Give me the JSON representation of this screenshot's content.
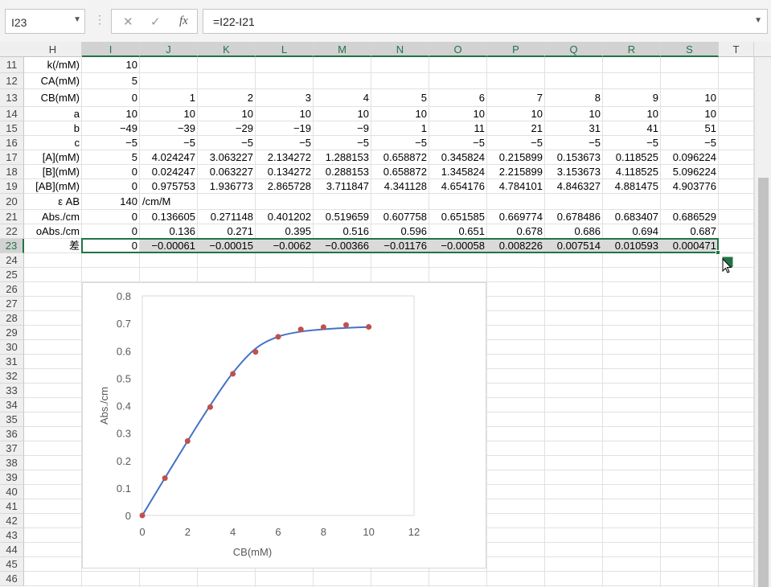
{
  "formula_bar": {
    "name_box": "I23",
    "cancel_glyph": "✕",
    "enter_glyph": "✓",
    "fx_glyph": "fx",
    "formula": "=I22-I21"
  },
  "columns": [
    "H",
    "I",
    "J",
    "K",
    "L",
    "M",
    "N",
    "O",
    "P",
    "Q",
    "R",
    "S",
    "T"
  ],
  "rows": [
    {
      "n": "11",
      "label": "k(/mM)",
      "cells": [
        "10"
      ]
    },
    {
      "n": "12",
      "label": "CA(mM)",
      "cells": [
        "5"
      ]
    },
    {
      "n": "13",
      "label": "CB(mM)",
      "cells": [
        "0",
        "1",
        "2",
        "3",
        "4",
        "5",
        "6",
        "7",
        "8",
        "9",
        "10"
      ]
    },
    {
      "n": "14",
      "label": "a",
      "cells": [
        "10",
        "10",
        "10",
        "10",
        "10",
        "10",
        "10",
        "10",
        "10",
        "10",
        "10"
      ]
    },
    {
      "n": "15",
      "label": "b",
      "cells": [
        "−49",
        "−39",
        "−29",
        "−19",
        "−9",
        "1",
        "11",
        "21",
        "31",
        "41",
        "51"
      ]
    },
    {
      "n": "16",
      "label": "c",
      "cells": [
        "−5",
        "−5",
        "−5",
        "−5",
        "−5",
        "−5",
        "−5",
        "−5",
        "−5",
        "−5",
        "−5"
      ]
    },
    {
      "n": "17",
      "label": "[A](mM)",
      "cells": [
        "5",
        "4.024247",
        "3.063227",
        "2.134272",
        "1.288153",
        "0.658872",
        "0.345824",
        "0.215899",
        "0.153673",
        "0.118525",
        "0.096224"
      ]
    },
    {
      "n": "18",
      "label": "[B](mM)",
      "cells": [
        "0",
        "0.024247",
        "0.063227",
        "0.134272",
        "0.288153",
        "0.658872",
        "1.345824",
        "2.215899",
        "3.153673",
        "4.118525",
        "5.096224"
      ]
    },
    {
      "n": "19",
      "label": "[AB](mM)",
      "cells": [
        "0",
        "0.975753",
        "1.936773",
        "2.865728",
        "3.711847",
        "4.341128",
        "4.654176",
        "4.784101",
        "4.846327",
        "4.881475",
        "4.903776"
      ]
    },
    {
      "n": "20",
      "label": "ε AB",
      "cells": [
        "140",
        "/cm/M"
      ]
    },
    {
      "n": "21",
      "label": "Abs./cm",
      "cells": [
        "0",
        "0.136605",
        "0.271148",
        "0.401202",
        "0.519659",
        "0.607758",
        "0.651585",
        "0.669774",
        "0.678486",
        "0.683407",
        "0.686529"
      ]
    },
    {
      "n": "22",
      "label": "oAbs./cm",
      "cells": [
        "0",
        "0.136",
        "0.271",
        "0.395",
        "0.516",
        "0.596",
        "0.651",
        "0.678",
        "0.686",
        "0.694",
        "0.687"
      ]
    },
    {
      "n": "23",
      "label": "差",
      "cells": [
        "0",
        "−0.00061",
        "−0.00015",
        "−0.0062",
        "−0.00366",
        "−0.01176",
        "−0.00058",
        "0.008226",
        "0.007514",
        "0.010593",
        "0.000471"
      ]
    },
    {
      "n": "24",
      "label": "",
      "cells": []
    },
    {
      "n": "25",
      "label": "",
      "cells": []
    },
    {
      "n": "26",
      "label": "",
      "cells": []
    },
    {
      "n": "27",
      "label": "",
      "cells": []
    },
    {
      "n": "28",
      "label": "",
      "cells": []
    },
    {
      "n": "29",
      "label": "",
      "cells": []
    },
    {
      "n": "30",
      "label": "",
      "cells": []
    },
    {
      "n": "31",
      "label": "",
      "cells": []
    },
    {
      "n": "32",
      "label": "",
      "cells": []
    },
    {
      "n": "33",
      "label": "",
      "cells": []
    },
    {
      "n": "34",
      "label": "",
      "cells": []
    },
    {
      "n": "35",
      "label": "",
      "cells": []
    },
    {
      "n": "36",
      "label": "",
      "cells": []
    },
    {
      "n": "37",
      "label": "",
      "cells": []
    },
    {
      "n": "38",
      "label": "",
      "cells": []
    },
    {
      "n": "39",
      "label": "",
      "cells": []
    },
    {
      "n": "40",
      "label": "",
      "cells": []
    },
    {
      "n": "41",
      "label": "",
      "cells": []
    },
    {
      "n": "42",
      "label": "",
      "cells": []
    },
    {
      "n": "43",
      "label": "",
      "cells": []
    },
    {
      "n": "44",
      "label": "",
      "cells": []
    },
    {
      "n": "45",
      "label": "",
      "cells": []
    },
    {
      "n": "46",
      "label": "",
      "cells": []
    }
  ],
  "selection": {
    "row": "23",
    "from_col": "I",
    "to_col": "S"
  },
  "colors": {
    "accent": "#217346",
    "line": "#4472c4",
    "marker": "#c0504d"
  },
  "chart_data": {
    "type": "scatter",
    "xlabel": "CB(mM)",
    "ylabel": "Abs./cm",
    "xlim": [
      0,
      12
    ],
    "ylim": [
      0,
      0.8
    ],
    "xticks": [
      "0",
      "2",
      "4",
      "6",
      "8",
      "10",
      "12"
    ],
    "yticks": [
      "0",
      "0.1",
      "0.2",
      "0.3",
      "0.4",
      "0.5",
      "0.6",
      "0.7",
      "0.8"
    ],
    "grid": false,
    "series": [
      {
        "style": "smooth-line",
        "x": [
          0,
          1,
          2,
          3,
          4,
          5,
          6,
          7,
          8,
          9,
          10
        ],
        "y": [
          0,
          0.136605,
          0.271148,
          0.401202,
          0.519659,
          0.607758,
          0.651585,
          0.669774,
          0.678486,
          0.683407,
          0.686529
        ]
      },
      {
        "style": "markers",
        "x": [
          0,
          1,
          2,
          3,
          4,
          5,
          6,
          7,
          8,
          9,
          10
        ],
        "y": [
          0,
          0.136,
          0.271,
          0.395,
          0.516,
          0.596,
          0.651,
          0.678,
          0.686,
          0.694,
          0.687
        ]
      }
    ]
  }
}
